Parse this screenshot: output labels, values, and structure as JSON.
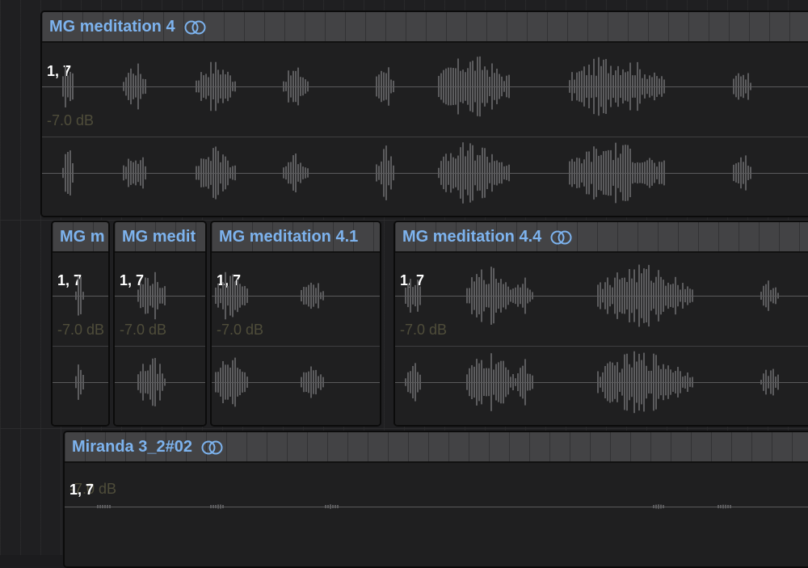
{
  "regions": {
    "r1": {
      "title": "MG meditation 4",
      "gain": "-7.0 dB",
      "channel": "1, 7",
      "looped": true
    },
    "r2": {
      "title": "MG m",
      "gain": "-7.0 dB",
      "channel": "1, 7",
      "looped": false
    },
    "r3": {
      "title": "MG medit",
      "gain": "-7.0 dB",
      "channel": "1, 7",
      "looped": false
    },
    "r4": {
      "title": "MG meditation 4.1",
      "gain": "-7.0 dB",
      "channel": "1, 7",
      "looped": false
    },
    "r5": {
      "title": "MG meditation 4.4",
      "gain": "-7.0 dB",
      "channel": "1, 7",
      "looped": true
    },
    "r6": {
      "title": "Miranda 3_2#02",
      "gain": "-7.0 dB",
      "channel": "1, 7",
      "looped": true
    }
  },
  "colors": {
    "region_title": "#7db3ee",
    "waveform": "#5c5c5e",
    "gain_text": "#4f4d3a",
    "header_bg": "#434345"
  },
  "icons": {
    "loop": "loop-icon"
  }
}
